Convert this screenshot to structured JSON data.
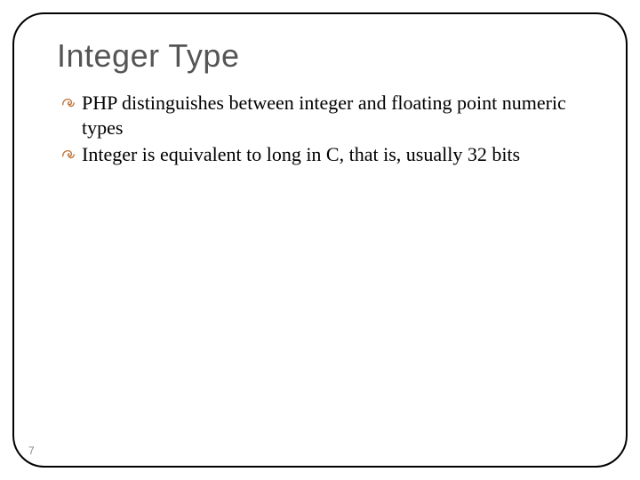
{
  "slide": {
    "title": "Integer Type",
    "bullets": [
      "PHP distinguishes between integer and floating point numeric types",
      "Integer is equivalent to long in C, that is, usually 32 bits"
    ],
    "page_number": "7"
  }
}
